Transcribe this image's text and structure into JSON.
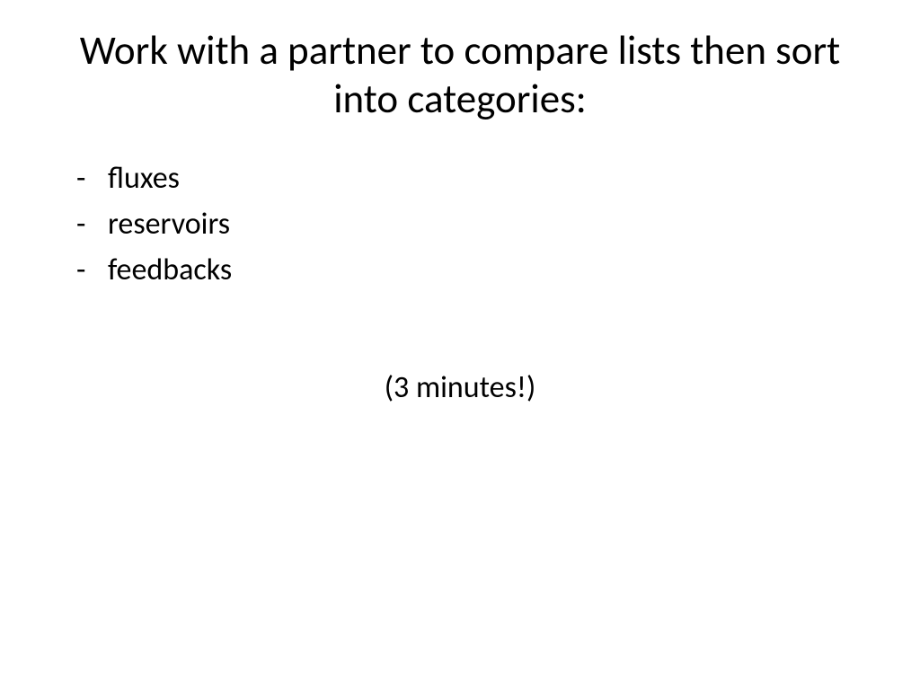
{
  "title": "Work with a partner to compare lists then sort into categories:",
  "bullets": {
    "item0": "fluxes",
    "item1": "reservoirs",
    "item2": "feedbacks"
  },
  "timer": "(3 minutes!)"
}
